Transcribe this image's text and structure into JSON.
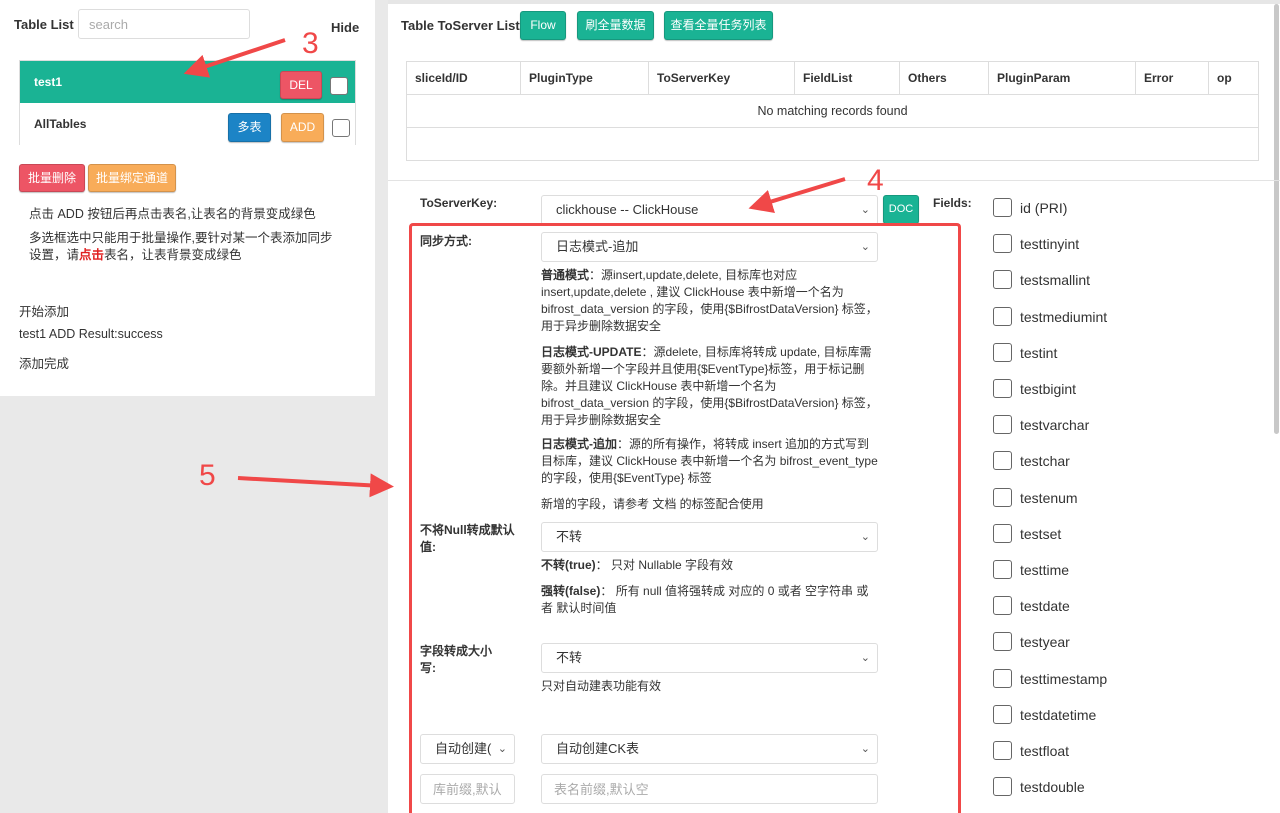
{
  "left": {
    "title": "Table List",
    "search_placeholder": "search",
    "hide": "Hide",
    "rows": [
      {
        "name": "test1",
        "del": "DEL"
      },
      {
        "name": "AllTables",
        "multi": "多表",
        "add": "ADD"
      }
    ],
    "batch_delete": "批量删除",
    "batch_bind": "批量绑定通道",
    "note1": "点击 ADD 按钮后再点击表名,让表名的背景变成绿色",
    "note2_a": "多选框选中只能用于批量操作,要针对某一个表添加同步设置，请",
    "note2_hl": "点击",
    "note2_b": "表名，让表背景变成绿色",
    "log": [
      "开始添加",
      "test1 ADD Result:success",
      "添加完成"
    ]
  },
  "right": {
    "title": "Table ToServer List",
    "flow": "Flow",
    "refresh_all": "刷全量数据",
    "view_all_tasks": "查看全量任务列表",
    "columns": [
      "sliceId/ID",
      "PluginType",
      "ToServerKey",
      "FieldList",
      "Others",
      "PluginParam",
      "Error",
      "op"
    ],
    "no_records": "No matching records found",
    "toserverkey_label": "ToServerKey:",
    "toserverkey_value": "clickhouse -- ClickHouse",
    "doc": "DOC",
    "fields_label": "Fields:",
    "sync_label": "同步方式:",
    "sync_value": "日志模式-追加",
    "sync_desc": {
      "normal_title": "普通模式",
      "normal_text": "：源insert,update,delete, 目标库也对应insert,update,delete , 建议 ClickHouse 表中新增一个名为 bifrost_data_version 的字段，使用{$BifrostDataVersion} 标签，用于异步删除数据安全",
      "update_title": "日志模式-UPDATE",
      "update_text": "：源delete, 目标库将转成 update, 目标库需要额外新增一个字段并且使用{$EventType}标签，用于标记删除。并且建议 ClickHouse 表中新增一个名为 bifrost_data_version 的字段，使用{$BifrostDataVersion} 标签，用于异步删除数据安全",
      "append_title": "日志模式-追加",
      "append_text": "：源的所有操作，将转成 insert 追加的方式写到目标库，建议 ClickHouse 表中新增一个名为 bifrost_event_type 的字段，使用{$EventType} 标签",
      "new_field": "新增的字段，请参考 文档 的标签配合使用"
    },
    "null_label": "不将Null转成默认值:",
    "null_value": "不转",
    "null_desc": {
      "true_title": "不转(true)",
      "true_text": "：  只对 Nullable 字段有效",
      "false_title": "强转(false)",
      "false_text": "：  所有 null 值将强转成 对应的 0 或者 空字符串 或者 默认时间值"
    },
    "case_label": "字段转成大小写:",
    "case_value": "不转",
    "case_desc": "只对自动建表功能有效",
    "auto_create_left": "自动创建(",
    "auto_create_right": "自动创建CK表",
    "db_prefix_placeholder": "库前缀,默认空",
    "table_prefix_placeholder": "表名前缀,默认空",
    "fields": [
      "id (PRI)",
      "testtinyint",
      "testsmallint",
      "testmediumint",
      "testint",
      "testbigint",
      "testvarchar",
      "testchar",
      "testenum",
      "testset",
      "testtime",
      "testdate",
      "testyear",
      "testtimestamp",
      "testdatetime",
      "testfloat",
      "testdouble"
    ]
  },
  "annotations": [
    "3",
    "4",
    "5"
  ],
  "colors": {
    "green": "#1ab394",
    "red": "#ed5565",
    "orange": "#f8ac59",
    "blue": "#1c84c6",
    "annotation": "#f04848"
  }
}
